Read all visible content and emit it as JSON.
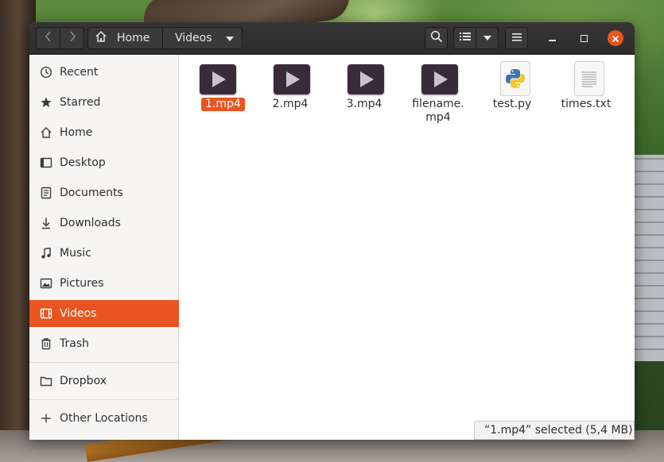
{
  "window": {
    "nav_back_icon": "chevron-left-icon",
    "nav_forward_icon": "chevron-right-icon"
  },
  "breadcrumb": {
    "home_label": "Home",
    "current_label": "Videos"
  },
  "sidebar": {
    "items": [
      {
        "label": "Recent",
        "icon": "clock-icon"
      },
      {
        "label": "Starred",
        "icon": "star-icon"
      },
      {
        "label": "Home",
        "icon": "home-icon"
      },
      {
        "label": "Desktop",
        "icon": "desktop-icon"
      },
      {
        "label": "Documents",
        "icon": "document-icon"
      },
      {
        "label": "Downloads",
        "icon": "download-icon"
      },
      {
        "label": "Music",
        "icon": "music-icon"
      },
      {
        "label": "Pictures",
        "icon": "picture-icon"
      },
      {
        "label": "Videos",
        "icon": "video-icon",
        "active": true
      },
      {
        "label": "Trash",
        "icon": "trash-icon"
      },
      {
        "label": "Dropbox",
        "icon": "folder-icon"
      },
      {
        "label": "Other Locations",
        "icon": "plus-icon"
      }
    ]
  },
  "files": [
    {
      "name": "1.mp4",
      "type": "video",
      "selected": true
    },
    {
      "name": "2.mp4",
      "type": "video"
    },
    {
      "name": "3.mp4",
      "type": "video"
    },
    {
      "name_line1": "filename.",
      "name_line2": "mp4",
      "type": "video"
    },
    {
      "name": "test.py",
      "type": "python"
    },
    {
      "name": "times.txt",
      "type": "text"
    }
  ],
  "status": {
    "text": "“1.mp4” selected  (5,4 MB)"
  },
  "colors": {
    "accent": "#e95420",
    "headerbar": "#2d2d2d",
    "sidebar_bg": "#f6f5f4"
  }
}
